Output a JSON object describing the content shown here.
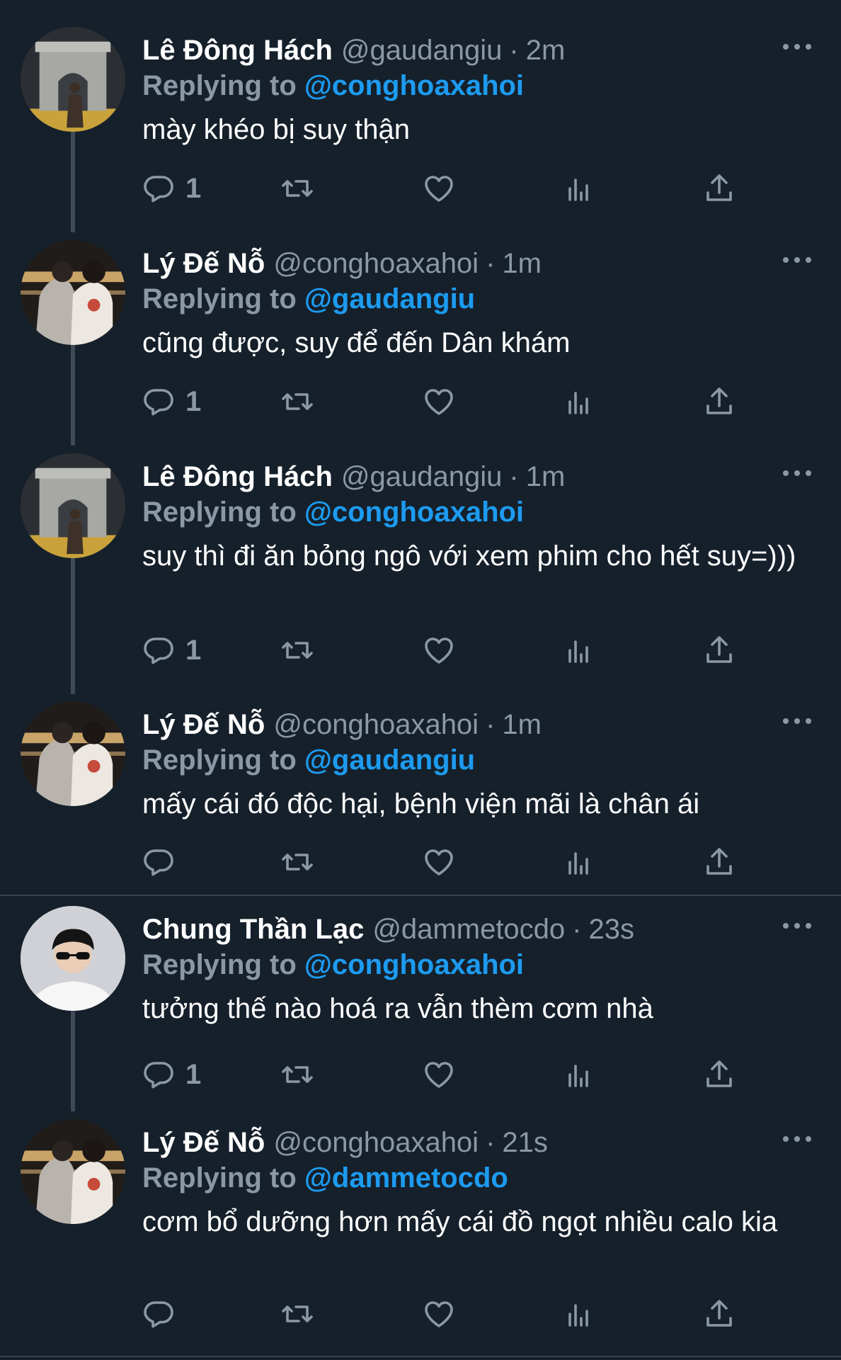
{
  "colors": {
    "background": "#15202b",
    "text_primary": "#ffffff",
    "text_secondary": "#8b98a5",
    "link": "#1d9bf0",
    "thread_line": "#3d4a57",
    "divider": "#38444d"
  },
  "icons": {
    "reply": "reply-icon",
    "retweet": "retweet-icon",
    "like": "heart-icon",
    "stats": "analytics-icon",
    "share": "share-icon",
    "more": "more-icon"
  },
  "tweets": [
    {
      "name": "Lê Đông Hách",
      "handle": "@gaudangiu",
      "separator": "·",
      "time": "2m",
      "replying_label": "Replying to",
      "replying_to": "@conghoaxahoi",
      "text": "mày khéo bị suy thận",
      "reply_count": "1",
      "avatar": "arch"
    },
    {
      "name": "Lý Đế Nỗ",
      "handle": "@conghoaxahoi",
      "separator": "·",
      "time": "1m",
      "replying_label": "Replying to",
      "replying_to": "@gaudangiu",
      "text": "cũng được, suy để đến Dân khám",
      "reply_count": "1",
      "avatar": "couple"
    },
    {
      "name": "Lê Đông Hách",
      "handle": "@gaudangiu",
      "separator": "·",
      "time": "1m",
      "replying_label": "Replying to",
      "replying_to": "@conghoaxahoi",
      "text": "suy thì đi ăn bỏng ngô với xem phim cho hết suy=)))",
      "reply_count": "1",
      "avatar": "arch"
    },
    {
      "name": "Lý Đế Nỗ",
      "handle": "@conghoaxahoi",
      "separator": "·",
      "time": "1m",
      "replying_label": "Replying to",
      "replying_to": "@gaudangiu",
      "text": "mấy cái đó độc hại, bệnh viện mãi là chân ái",
      "reply_count": "",
      "avatar": "couple"
    },
    {
      "name": "Chung Thần Lạc",
      "handle": "@dammetocdo",
      "separator": "·",
      "time": "23s",
      "replying_label": "Replying to",
      "replying_to": "@conghoaxahoi",
      "text": "tưởng thế nào hoá ra vẫn thèm cơm nhà",
      "reply_count": "1",
      "avatar": "boy"
    },
    {
      "name": "Lý Đế Nỗ",
      "handle": "@conghoaxahoi",
      "separator": "·",
      "time": "21s",
      "replying_label": "Replying to",
      "replying_to": "@dammetocdo",
      "text": "cơm bổ dưỡng hơn mấy cái đồ ngọt nhiều calo kia",
      "reply_count": "",
      "avatar": "couple"
    }
  ]
}
